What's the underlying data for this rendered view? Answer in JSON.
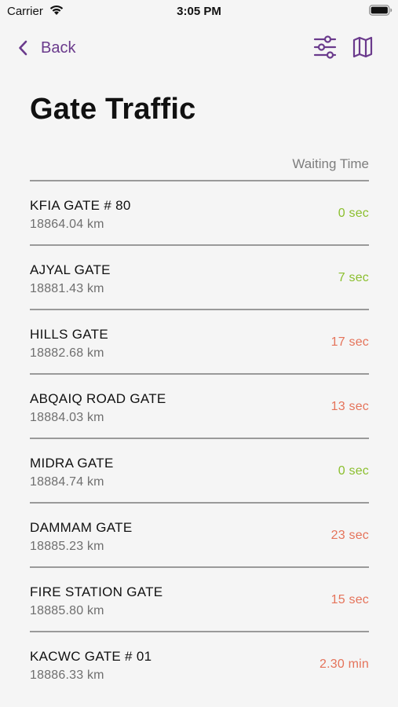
{
  "status_bar": {
    "carrier": "Carrier",
    "time": "3:05 PM"
  },
  "nav": {
    "back_label": "Back",
    "accent_color": "#6a3a8c",
    "icons": [
      "chevron-left-icon",
      "sliders-icon",
      "map-icon"
    ]
  },
  "page": {
    "title": "Gate Traffic",
    "column_header": "Waiting Time"
  },
  "gates": [
    {
      "name": "KFIA GATE # 80",
      "distance": "18864.04 km",
      "wait": "0 sec",
      "status": "ok"
    },
    {
      "name": "AJYAL GATE",
      "distance": "18881.43 km",
      "wait": "7 sec",
      "status": "ok"
    },
    {
      "name": "HILLS GATE",
      "distance": "18882.68 km",
      "wait": "17 sec",
      "status": "slow"
    },
    {
      "name": "ABQAIQ ROAD GATE",
      "distance": "18884.03 km",
      "wait": "13 sec",
      "status": "slow"
    },
    {
      "name": "MIDRA GATE",
      "distance": "18884.74 km",
      "wait": "0 sec",
      "status": "ok"
    },
    {
      "name": "DAMMAM GATE",
      "distance": "18885.23 km",
      "wait": "23 sec",
      "status": "slow"
    },
    {
      "name": "FIRE STATION GATE",
      "distance": "18885.80 km",
      "wait": "15 sec",
      "status": "slow"
    },
    {
      "name": "KACWC GATE # 01",
      "distance": "18886.33 km",
      "wait": "2.30 min",
      "status": "slow"
    }
  ],
  "status_colors": {
    "ok": "#8bbf2e",
    "slow": "#e5735a"
  }
}
